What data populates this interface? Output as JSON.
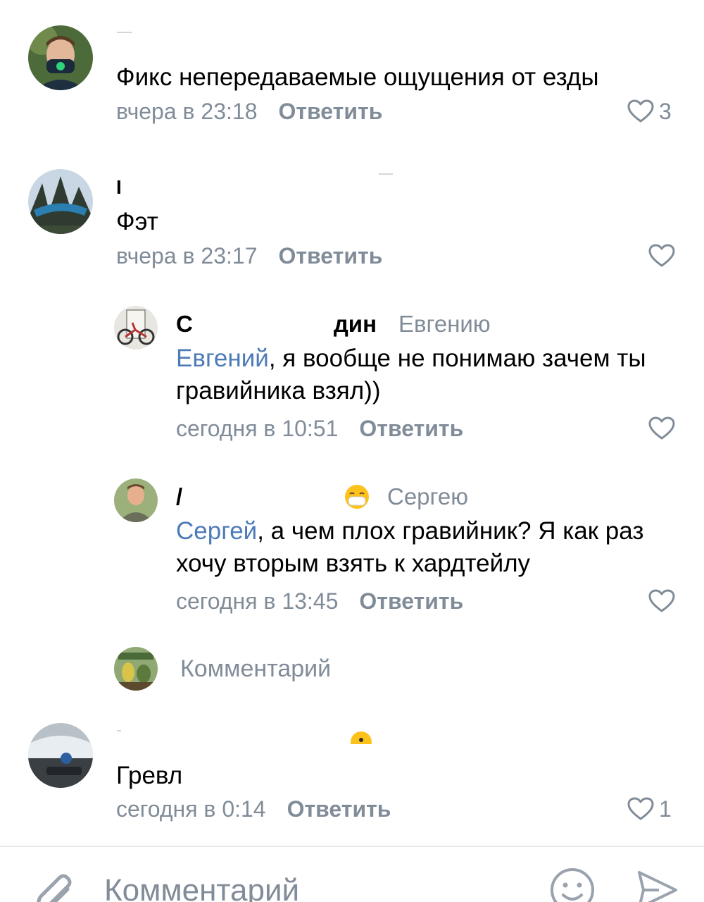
{
  "comments": [
    {
      "text": "Фикс непередаваемые ощущения от езды",
      "time": "вчера в 23:18",
      "reply_label": "Ответить",
      "likes": "3"
    },
    {
      "name_fragment": "I",
      "text": "Фэт",
      "time": "вчера в 23:17",
      "reply_label": "Ответить",
      "likes": ""
    },
    {
      "name_start": "С",
      "name_end": "дин",
      "reply_to": "Евгению",
      "mention": "Евгений",
      "text": ", я вообще не понимаю зачем ты гравийника взял))",
      "time": "сегодня в 10:51",
      "reply_label": "Ответить",
      "likes": ""
    },
    {
      "name_fragment": "/",
      "name_emoji": "😷",
      "reply_to": "Сергею",
      "mention": "Сергей",
      "text": ", а чем плох гравийник? Я как раз хочу вторым взять к хардтейлу",
      "time": "сегодня в 13:45",
      "reply_label": "Ответить",
      "likes": ""
    },
    {
      "text": "Гревл",
      "time": "сегодня в 0:14",
      "reply_label": "Ответить",
      "likes": "1"
    }
  ],
  "thread_reply": {
    "placeholder": "Комментарий"
  },
  "bottom_bar": {
    "placeholder": "Комментарий"
  },
  "colors": {
    "secondary_text": "#818c99",
    "mention": "#4d7bb8",
    "divider": "#e7e8ec"
  }
}
